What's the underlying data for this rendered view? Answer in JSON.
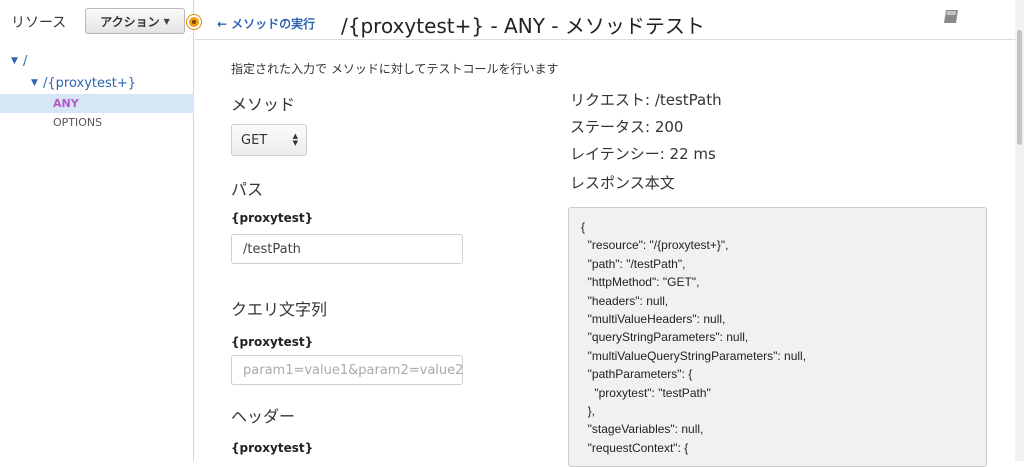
{
  "sidebar": {
    "title": "リソース",
    "action_button": "アクション",
    "tree": {
      "root": "/",
      "resource": "/{proxytest+}",
      "methods": [
        "ANY",
        "OPTIONS"
      ]
    }
  },
  "header": {
    "back_link": "メソッドの実行",
    "title": "/{proxytest+} - ANY - メソッドテスト"
  },
  "main": {
    "description": "指定された入力で メソッドに対してテストコールを行います",
    "method_section": "メソッド",
    "method_value": "GET",
    "path_section": "パス",
    "path_param_label": "{proxytest}",
    "path_param_value": "/testPath",
    "query_section": "クエリ文字列",
    "query_param_label": "{proxytest}",
    "query_placeholder": "param1=value1&param2=value2",
    "header_section": "ヘッダー",
    "header_param_label": "{proxytest}"
  },
  "response": {
    "request": "リクエスト: /testPath",
    "status": "ステータス: 200",
    "latency": "レイテンシー: 22 ms",
    "body_label": "レスポンス本文",
    "body_text": "{\n  \"resource\": \"/{proxytest+}\",\n  \"path\": \"/testPath\",\n  \"httpMethod\": \"GET\",\n  \"headers\": null,\n  \"multiValueHeaders\": null,\n  \"queryStringParameters\": null,\n  \"multiValueQueryStringParameters\": null,\n  \"pathParameters\": {\n    \"proxytest\": \"testPath\"\n  },\n  \"stageVariables\": null,\n  \"requestContext\": {"
  },
  "colors": {
    "link": "#2f64b0",
    "any_method": "#b459c4",
    "selected_row": "#d6e6f7",
    "badge": "#f39c12"
  }
}
